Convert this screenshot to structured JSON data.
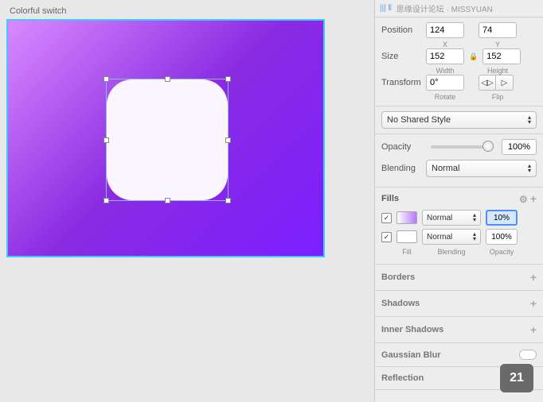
{
  "canvas": {
    "title": "Colorful switch"
  },
  "watermark": "思缘设计论坛 · MISSYUAN",
  "inspector": {
    "position": {
      "label": "Position",
      "x": "124",
      "y": "74",
      "xlabel": "X",
      "ylabel": "Y"
    },
    "size": {
      "label": "Size",
      "w": "152",
      "h": "152",
      "wlabel": "Width",
      "hlabel": "Height"
    },
    "transform": {
      "label": "Transform",
      "rotate": "0°",
      "rlabel": "Rotate",
      "fliplabel": "Flip"
    },
    "sharedStyle": "No Shared Style",
    "opacity": {
      "label": "Opacity",
      "value": "100%"
    },
    "blending": {
      "label": "Blending",
      "value": "Normal"
    },
    "fills": {
      "title": "Fills",
      "labels": {
        "fill": "Fill",
        "blending": "Blending",
        "opacity": "Opacity"
      },
      "rows": [
        {
          "blend": "Normal",
          "opacity": "10%",
          "highlighted": true,
          "grad": true
        },
        {
          "blend": "Normal",
          "opacity": "100%",
          "highlighted": false,
          "grad": false
        }
      ]
    },
    "sections": {
      "borders": "Borders",
      "shadows": "Shadows",
      "innerShadows": "Inner Shadows",
      "gaussian": "Gaussian Blur",
      "reflection": "Reflection"
    }
  },
  "pageBadge": "21"
}
